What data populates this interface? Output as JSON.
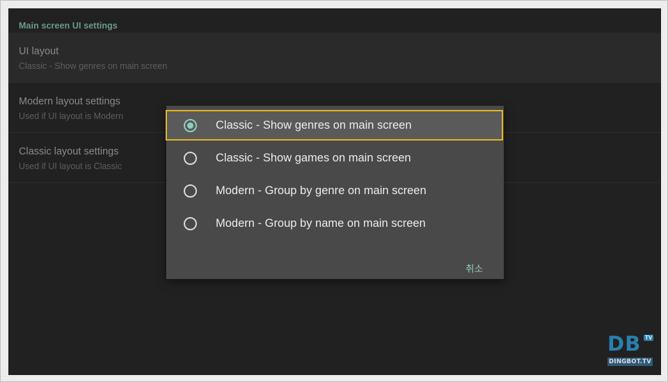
{
  "settings": {
    "section_header": "Main screen UI settings",
    "items": [
      {
        "title": "UI layout",
        "summary": "Classic - Show genres on main screen"
      },
      {
        "title": "Modern layout settings",
        "summary": "Used if UI layout is Modern"
      },
      {
        "title": "Classic layout settings",
        "summary": "Used if UI layout is Classic"
      }
    ]
  },
  "dialog": {
    "options": [
      {
        "label": "Classic - Show genres on main screen",
        "selected": true
      },
      {
        "label": "Classic - Show games on main screen",
        "selected": false
      },
      {
        "label": "Modern - Group by genre on main screen",
        "selected": false
      },
      {
        "label": "Modern - Group by name on main screen",
        "selected": false
      }
    ],
    "cancel_label": "취소"
  },
  "watermark": {
    "logo": "DB",
    "badge": "TV",
    "site": "DINGBOT.TV"
  },
  "colors": {
    "accent": "#8fcfbf",
    "focus_border": "#e2b61f",
    "section_header": "#6a9a8a"
  }
}
